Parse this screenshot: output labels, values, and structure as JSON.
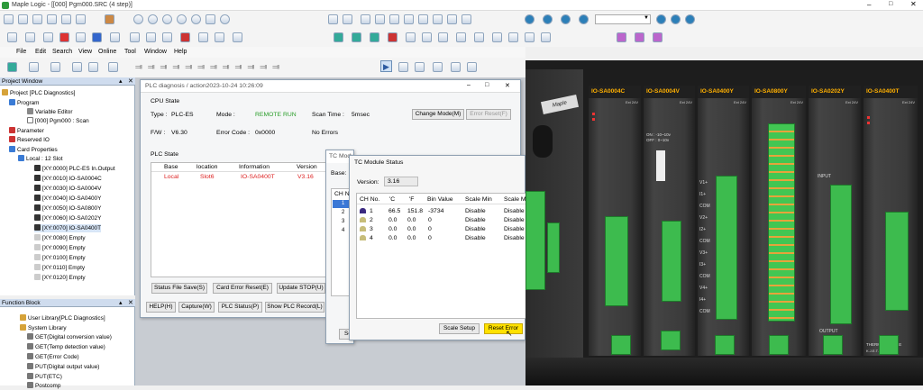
{
  "window": {
    "title": "Maple Logic - [[000] Pgm000.SRC (4 step)]"
  },
  "menu": [
    "File",
    "Edit",
    "Search",
    "View",
    "Online",
    "Tool",
    "Window",
    "Help"
  ],
  "project_window": {
    "title": "Project Window",
    "items": [
      "Project [PLC Diagnostics]",
      "Program",
      "Variable Editor",
      "[000] Pgm000 : Scan",
      "Parameter",
      "Reserved IO",
      "Card Properties",
      "Local : 12 Slot",
      "[XY:0000] PLC-ES In.Output",
      "[XY:0010] IO-SA0004C",
      "[XY:0030] IO-SA0004V",
      "[XY:0040] IO-SA0400Y",
      "[XY:0050] IO-SA0800Y",
      "[XY:0060] IO-SA0202Y",
      "[XY:0070] IO-SA0400T",
      "[XY:0080] Empty",
      "[XY:0090] Empty",
      "[XY:0100] Empty",
      "[XY:0110] Empty",
      "[XY:0120] Empty"
    ]
  },
  "function_block": {
    "title": "Function Block",
    "items": [
      "User Library[PLC Diagnostics]",
      "System Library",
      "GET(Digital conversion value)",
      "GET(Temp detection value)",
      "GET(Error Code)",
      "PUT(Digital output value)",
      "PUT(ETC)",
      "Postcomp"
    ]
  },
  "diag": {
    "title": "PLC diagnosis / action2023-10-24 10:26:09",
    "cpu_state": "CPU State",
    "type_label": "Type :",
    "type_value": "PLC-ES",
    "mode_label": "Mode :",
    "mode_value": "REMOTE RUN",
    "scan_label": "Scan Time :",
    "scan_value": "5msec",
    "change_mode": "Change Mode(M)",
    "error_reset": "Error Reset(F)",
    "fw_label": "F/W :",
    "fw_value": "V6.30",
    "err_code_label": "Error Code :",
    "err_code_value": "0x0000",
    "no_errors": "No Errors",
    "plc_state": "PLC State",
    "columns": [
      "Base",
      "location",
      "Information",
      "Version"
    ],
    "row": [
      "Local",
      "Slot6",
      "IO-SA0400T",
      "V3.16"
    ],
    "btn_status_save": "Status File Save(S)",
    "btn_card_reset": "Card Error Reset(E)",
    "btn_update_stop": "Update STOP(U)",
    "btn_help": "HELP(H)",
    "btn_capture": "Capture(W)",
    "btn_plc_status": "PLC Status(P)",
    "btn_show_record": "Show PLC Record(L)"
  },
  "tc_back": {
    "title": "TC Modu",
    "base_label": "Base:",
    "ch_hdr": "CH No",
    "chs": [
      "1",
      "2",
      "3",
      "4"
    ],
    "bottom_btn": "Se"
  },
  "tc": {
    "title": "TC Module Status",
    "version_label": "Version:",
    "version_value": "3.16",
    "columns": [
      "CH No.",
      "'C",
      "'F",
      "Bin Value",
      "Scale Min",
      "Scale Ma"
    ],
    "rows": [
      [
        "1",
        "66.5",
        "151.8",
        "-3734",
        "Disable",
        "Disable"
      ],
      [
        "2",
        "0.0",
        "0.0",
        "0",
        "Disable",
        "Disable"
      ],
      [
        "3",
        "0.0",
        "0.0",
        "0",
        "Disable",
        "Disable"
      ],
      [
        "4",
        "0.0",
        "0.0",
        "0",
        "Disable",
        "Disable"
      ]
    ],
    "scale_setup": "Scale Setup",
    "reset_error": "Reset Error"
  },
  "photo": {
    "modules": [
      "IO-SA0004C",
      "IO-SA0004V",
      "IO-SA0400Y",
      "IO-SA0800Y",
      "IO-SA0202Y",
      "IO-SA0400T"
    ],
    "cpu_label": "Maple",
    "ext24": "Ext 24V",
    "v_labels": [
      "V1+",
      "I1+",
      "COM",
      "V2+",
      "I2+",
      "COM",
      "V3+",
      "I3+",
      "COM",
      "V4+",
      "I4+",
      "COM"
    ],
    "range_text": "ON : -10~10v",
    "range_text2": "OFF : 0~10v",
    "input_label": "INPUT",
    "output_label": "OUTPUT",
    "thermo_label": "THERMO COUPLE",
    "thermo_types": "K.J.E.T.R.S.B.N"
  }
}
